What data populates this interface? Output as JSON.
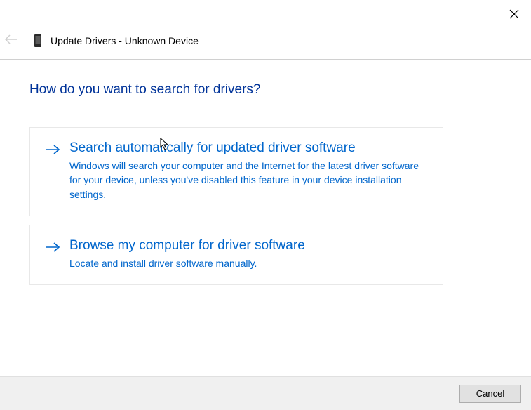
{
  "colors": {
    "linkBlue": "#0066cc",
    "headingBlue": "#003399"
  },
  "window": {
    "title": "Update Drivers - Unknown Device"
  },
  "page": {
    "heading": "How do you want to search for drivers?"
  },
  "options": [
    {
      "title": "Search automatically for updated driver software",
      "description": "Windows will search your computer and the Internet for the latest driver software for your device, unless you've disabled this feature in your device installation settings."
    },
    {
      "title": "Browse my computer for driver software",
      "description": "Locate and install driver software manually."
    }
  ],
  "footer": {
    "cancel_label": "Cancel"
  }
}
